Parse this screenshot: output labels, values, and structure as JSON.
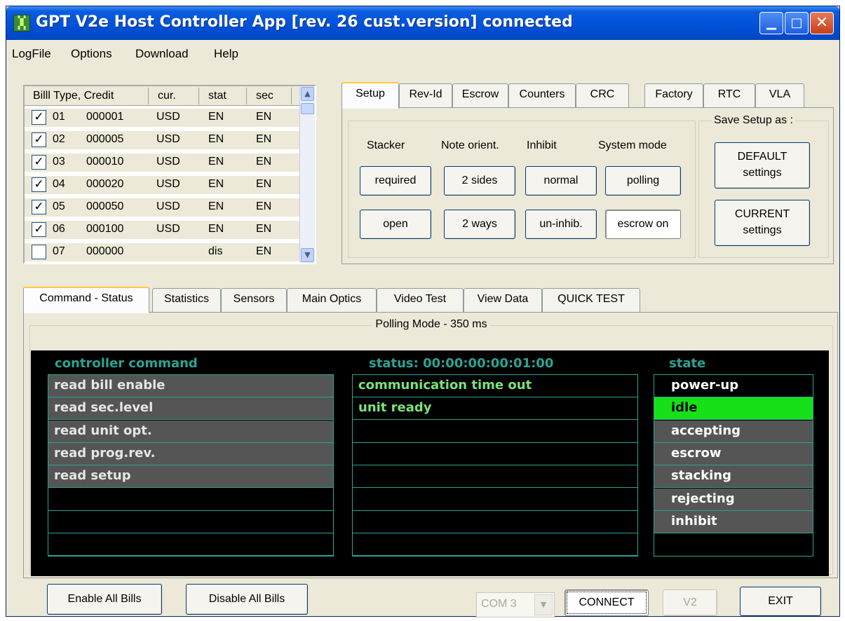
{
  "window": {
    "title": "GPT V2e Host Controller App  [rev. 26 cust.version] connected",
    "minimize": "▁",
    "maximize": "□",
    "close": "✕"
  },
  "menu": [
    "LogFile",
    "Options",
    "Download",
    "Help"
  ],
  "bill_table": {
    "headers": [
      "Billl Type, Credit",
      "cur.",
      "stat",
      "sec"
    ],
    "rows": [
      {
        "checked": true,
        "num": "01",
        "credit": "000001",
        "cur": "USD",
        "stat": "EN",
        "sec": "EN"
      },
      {
        "checked": true,
        "num": "02",
        "credit": "000005",
        "cur": "USD",
        "stat": "EN",
        "sec": "EN"
      },
      {
        "checked": true,
        "num": "03",
        "credit": "000010",
        "cur": "USD",
        "stat": "EN",
        "sec": "EN"
      },
      {
        "checked": true,
        "num": "04",
        "credit": "000020",
        "cur": "USD",
        "stat": "EN",
        "sec": "EN"
      },
      {
        "checked": true,
        "num": "05",
        "credit": "000050",
        "cur": "USD",
        "stat": "EN",
        "sec": "EN"
      },
      {
        "checked": true,
        "num": "06",
        "credit": "000100",
        "cur": "USD",
        "stat": "EN",
        "sec": "EN"
      },
      {
        "checked": false,
        "num": "07",
        "credit": "000000",
        "cur": "",
        "stat": "dis",
        "sec": "EN"
      }
    ]
  },
  "top_tabs": [
    "Setup",
    "Rev-Id",
    "Escrow",
    "Counters",
    "CRC",
    "Factory",
    "RTC",
    "VLA"
  ],
  "setup": {
    "labels": [
      "Stacker",
      "Note orient.",
      "Inhibit",
      "System mode"
    ],
    "row1": [
      "required",
      "2 sides",
      "normal",
      "polling"
    ],
    "row2": [
      "open",
      "2 ways",
      "un-inhib.",
      "escrow on"
    ],
    "save_label": "Save Setup as :",
    "default_btn": [
      "DEFAULT",
      "settings"
    ],
    "current_btn": [
      "CURRENT",
      "settings"
    ]
  },
  "bottom_tabs": [
    "Command - Status",
    "Statistics",
    "Sensors",
    "Main Optics",
    "Video Test",
    "View Data",
    "QUICK TEST"
  ],
  "polling_label": "Polling Mode - 350 ms",
  "monitor": {
    "command_title": "controller command",
    "status_title": "status: 00:00:00:00:01:00",
    "state_title": "state",
    "commands": [
      "read bill enable",
      "read sec.level",
      "read unit opt.",
      "read prog.rev.",
      "read setup"
    ],
    "statuses": [
      "communication time out",
      "unit ready"
    ],
    "states": [
      "power-up",
      "idle",
      "accepting",
      "escrow",
      "stacking",
      "rejecting",
      "inhibit"
    ],
    "active_state": "idle",
    "active_color": "#18e018",
    "text_color": "#7be37b",
    "border_color": "#2ba394"
  },
  "footer": {
    "enable_all": "Enable All Bills",
    "disable_all": "Disable All Bills",
    "com_port": "COM 3",
    "connect": "CONNECT",
    "v2": "V2",
    "exit": "EXIT"
  }
}
